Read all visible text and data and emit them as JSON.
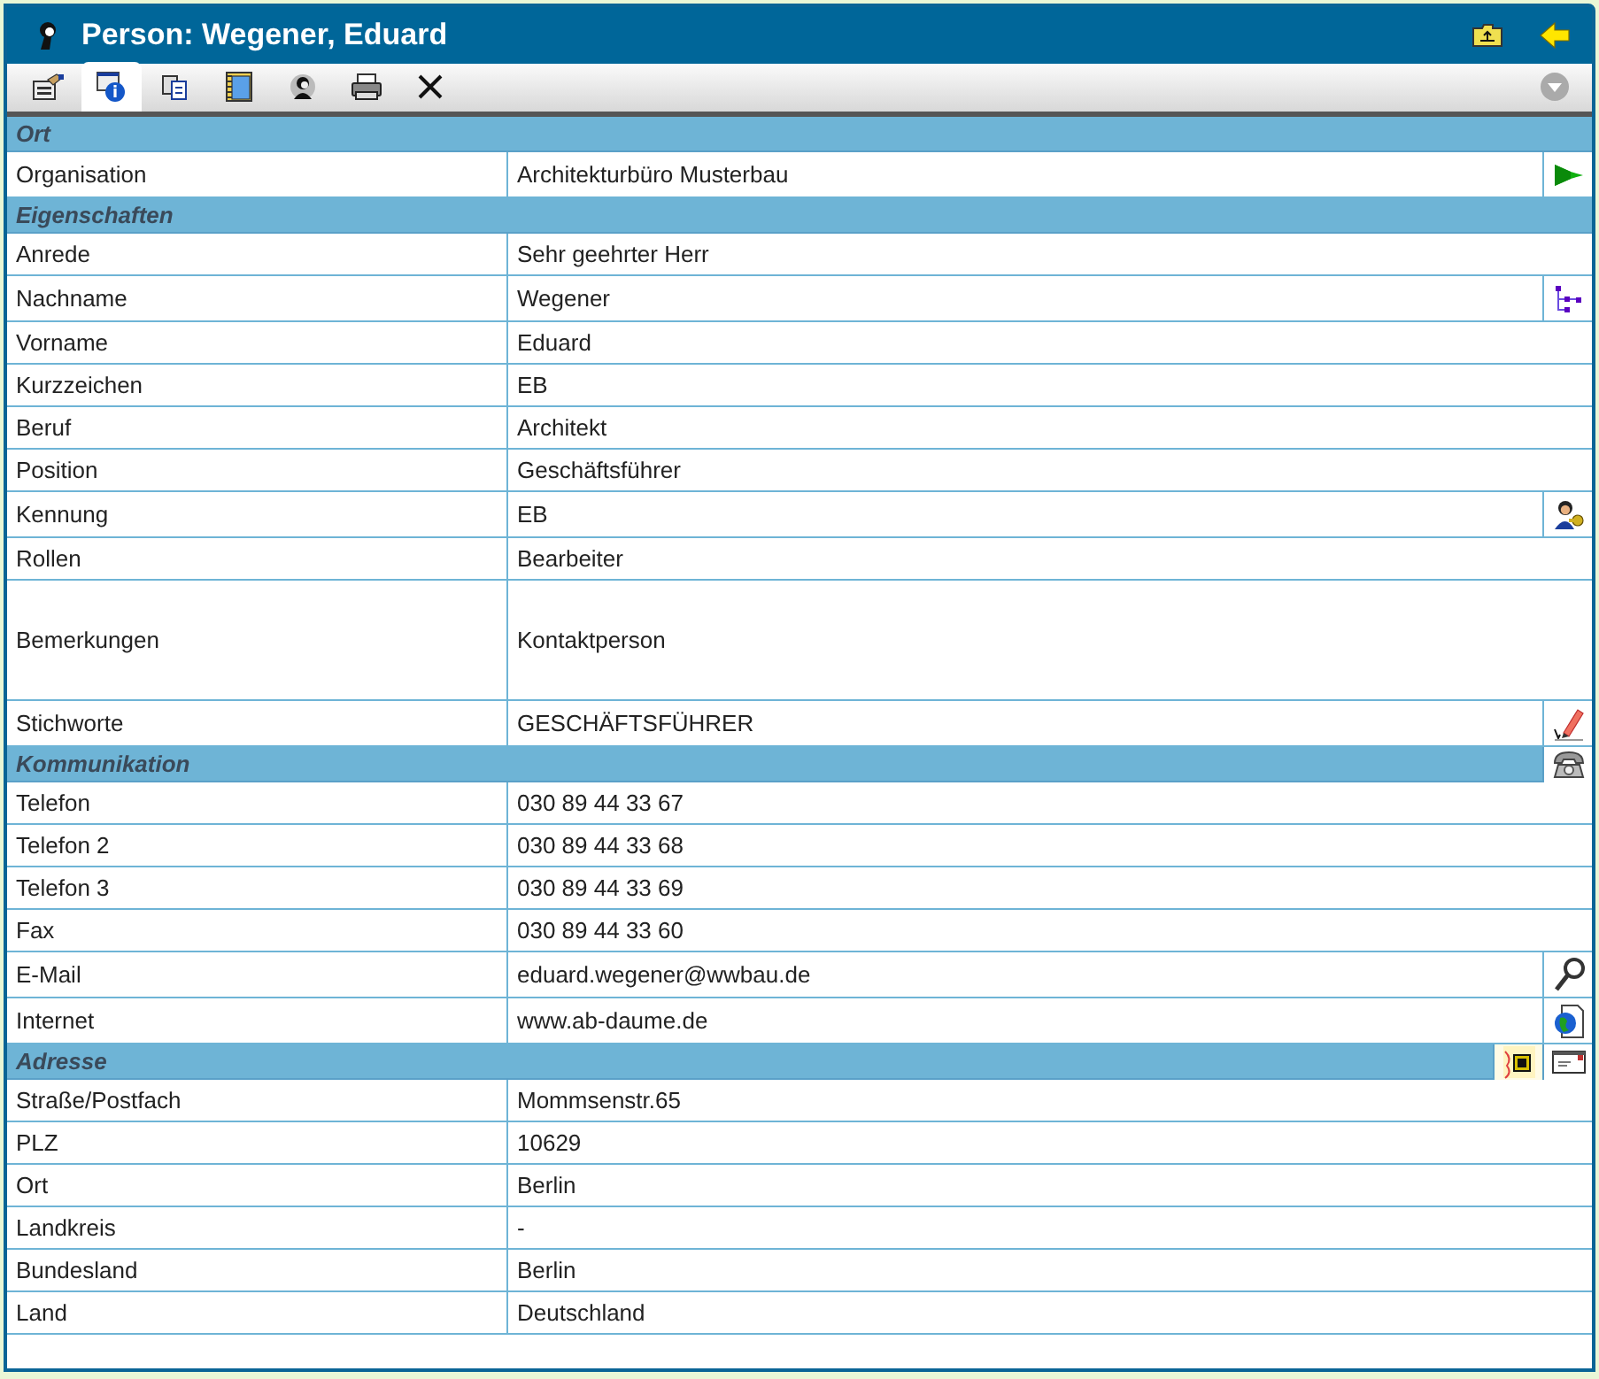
{
  "window": {
    "title": "Person: Wegener, Eduard"
  },
  "toolbar": [
    {
      "kind": "properties",
      "selected": false
    },
    {
      "kind": "info",
      "selected": true
    },
    {
      "kind": "copy",
      "selected": false
    },
    {
      "kind": "notebook",
      "selected": false
    },
    {
      "kind": "person",
      "selected": false
    },
    {
      "kind": "print",
      "selected": false
    },
    {
      "kind": "delete",
      "selected": false
    }
  ],
  "sections": [
    {
      "title": "Ort",
      "rows": [
        {
          "label": "Organisation",
          "value": "Architekturbüro Musterbau"
        }
      ]
    },
    {
      "title": "Eigenschaften",
      "rows": [
        {
          "label": "Anrede",
          "value": "Sehr geehrter Herr"
        },
        {
          "label": "Nachname",
          "value": "Wegener"
        },
        {
          "label": "Vorname",
          "value": "Eduard"
        },
        {
          "label": "Kurzzeichen",
          "value": "EB"
        },
        {
          "label": "Beruf",
          "value": "Architekt"
        },
        {
          "label": "Position",
          "value": "Geschäftsführer"
        },
        {
          "label": "Kennung",
          "value": "EB"
        },
        {
          "label": "Rollen",
          "value": "Bearbeiter"
        },
        {
          "label": "Bemerkungen",
          "value": "Kontaktperson"
        },
        {
          "label": "Stichworte",
          "value": "GESCHÄFTSFÜHRER"
        }
      ]
    },
    {
      "title": "Kommunikation",
      "rows": [
        {
          "label": "Telefon",
          "value": "030 89 44 33 67"
        },
        {
          "label": "Telefon 2",
          "value": "030 89 44 33 68"
        },
        {
          "label": "Telefon 3",
          "value": "030 89 44 33 69"
        },
        {
          "label": "Fax",
          "value": "030 89 44 33 60"
        },
        {
          "label": "E-Mail",
          "value": "eduard.wegener@wwbau.de"
        },
        {
          "label": "Internet",
          "value": "www.ab-daume.de"
        }
      ]
    },
    {
      "title": "Adresse",
      "rows": [
        {
          "label": "Straße/Postfach",
          "value": "Mommsenstr.65"
        },
        {
          "label": "PLZ",
          "value": "10629"
        },
        {
          "label": "Ort",
          "value": "Berlin"
        },
        {
          "label": "Landkreis",
          "value": "-"
        },
        {
          "label": "Bundesland",
          "value": "Berlin"
        },
        {
          "label": "Land",
          "value": "Deutschland"
        }
      ]
    }
  ]
}
